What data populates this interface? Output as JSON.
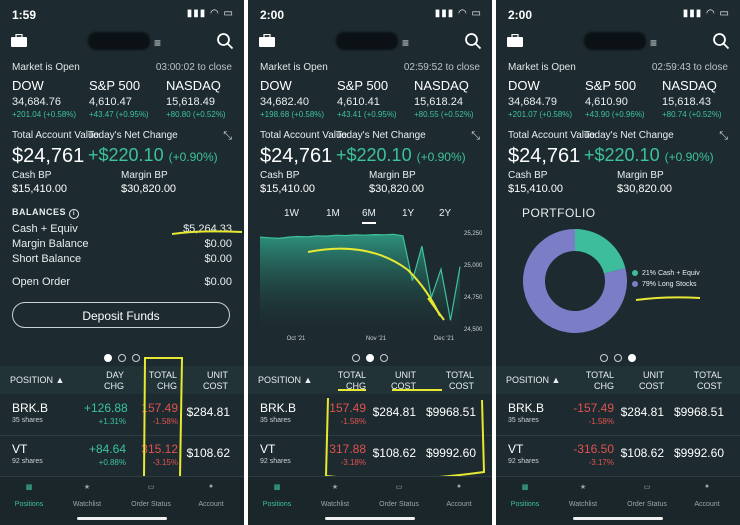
{
  "colors": {
    "bg": "#1d2b30",
    "green": "#3dc29a",
    "red": "#e0524e",
    "cash": "#3dbd9c",
    "stocks": "#7b7ec6",
    "highlight": "#e6e832"
  },
  "tabs": [
    {
      "label": "Positions",
      "icon": "briefcase-icon"
    },
    {
      "label": "Watchlist",
      "icon": "star-icon"
    },
    {
      "label": "Order Status",
      "icon": "folder-icon"
    },
    {
      "label": "Account",
      "icon": "person-icon"
    }
  ],
  "common": {
    "market_status": "Market is Open",
    "tav_label": "Total Account Value",
    "tav": "$24,761",
    "tnc_label": "Today's Net Change",
    "tnc": "+$220.10",
    "tnc_pct": "(+0.90%)",
    "cash_bp_label": "Cash BP",
    "cash_bp": "$15,410.00",
    "margin_bp_label": "Margin BP",
    "margin_bp": "$30,820.00",
    "index_names": [
      "DOW",
      "S&P 500",
      "NASDAQ"
    ],
    "shares": [
      "35 shares",
      "92 shares"
    ],
    "tickers": [
      "BRK.B",
      "VT"
    ]
  },
  "screens": [
    {
      "time": "1:59",
      "close_text": "03:00:02 to close",
      "indices": [
        {
          "value": "34,684.76",
          "change": "+201.04 (+0.58%)"
        },
        {
          "value": "4,610.47",
          "change": "+43.47 (+0.95%)"
        },
        {
          "value": "15,618.49",
          "change": "+80.80 (+0.52%)"
        }
      ],
      "balances": {
        "title": "BALANCES",
        "rows": [
          {
            "label": "Cash + Equiv",
            "value": "$5,264.33"
          },
          {
            "label": "Margin Balance",
            "value": "$0.00"
          },
          {
            "label": "Short Balance",
            "value": "$0.00"
          }
        ],
        "open_order_label": "Open Order",
        "open_order": "$0.00"
      },
      "deposit": "Deposit Funds",
      "headers": {
        "position": "POSITION",
        "day_chg": [
          "DAY",
          "CHG"
        ],
        "total_chg": [
          "TOTAL",
          "CHG"
        ],
        "unit_cost": [
          "UNIT",
          "COST"
        ]
      },
      "rows": [
        {
          "day": "+126.88",
          "day_pct": "+1.31%",
          "total": "157.49",
          "total_pct": "-1.58%",
          "cost": "$284.81"
        },
        {
          "day": "+84.64",
          "day_pct": "+0.88%",
          "total": "315.12",
          "total_pct": "-3.15%",
          "cost": "$108.62"
        }
      ]
    },
    {
      "time": "2:00",
      "close_text": "02:59:52 to close",
      "indices": [
        {
          "value": "34,682.40",
          "change": "+198.68 (+0.58%)"
        },
        {
          "value": "4,610.41",
          "change": "+43.41 (+0.95%)"
        },
        {
          "value": "15,618.24",
          "change": "+80.55 (+0.52%)"
        }
      ],
      "ranges": [
        "1W",
        "1M",
        "6M",
        "1Y",
        "2Y"
      ],
      "chart_data": {
        "type": "area",
        "x_ticks": [
          "Oct '21",
          "Nov '21",
          "Dec '21"
        ],
        "y_ticks": [
          "25,250",
          "25,000",
          "24,750",
          "24,500"
        ],
        "ylim": [
          24500,
          25250
        ],
        "values": [
          25210,
          25205,
          25200,
          25210,
          25215,
          25212,
          25220,
          25218,
          25225,
          25222,
          25228,
          25225,
          25230,
          25228,
          25232,
          25220,
          24870,
          25140,
          24740,
          24960,
          24560,
          24980
        ]
      },
      "headers": {
        "position": "POSITION",
        "total_chg": [
          "TOTAL",
          "CHG"
        ],
        "unit_cost": [
          "UNIT",
          "COST"
        ],
        "total_cost": [
          "TOTAL",
          "COST"
        ]
      },
      "rows": [
        {
          "total": "157.49",
          "total_pct": "-1.58%",
          "cost": "$284.81",
          "total_cost": "$9968.51"
        },
        {
          "total": "317.88",
          "total_pct": "-3.18%",
          "cost": "$108.62",
          "total_cost": "$9992.60"
        }
      ]
    },
    {
      "time": "2:00",
      "close_text": "02:59:43 to close",
      "indices": [
        {
          "value": "34,684.79",
          "change": "+201.07 (+0.58%)"
        },
        {
          "value": "4,610.90",
          "change": "+43.90 (+0.96%)"
        },
        {
          "value": "15,618.43",
          "change": "+80.74 (+0.52%)"
        }
      ],
      "portfolio": {
        "title": "PORTFOLIO",
        "slices": [
          {
            "label": "Cash + Equiv",
            "pct": "21%",
            "value": 21
          },
          {
            "label": "Long Stocks",
            "pct": "79%",
            "value": 79
          }
        ]
      },
      "headers": {
        "position": "POSITION",
        "total_chg": [
          "TOTAL",
          "CHG"
        ],
        "unit_cost": [
          "UNIT",
          "COST"
        ],
        "total_cost": [
          "TOTAL",
          "COST"
        ]
      },
      "rows": [
        {
          "total": "-157.49",
          "total_pct": "-1.58%",
          "cost": "$284.81",
          "total_cost": "$9968.51"
        },
        {
          "total": "-316.50",
          "total_pct": "-3.17%",
          "cost": "$108.62",
          "total_cost": "$9992.60"
        }
      ]
    }
  ]
}
